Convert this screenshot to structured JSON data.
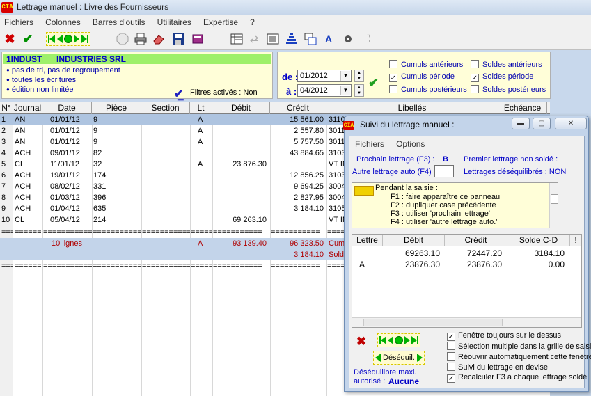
{
  "window": {
    "title": "Lettrage manuel : Livre des Fournisseurs",
    "logo": "CIA"
  },
  "menu": [
    "Fichiers",
    "Colonnes",
    "Barres d'outils",
    "Utilitaires",
    "Expertise",
    "?"
  ],
  "header": {
    "account_code": "1INDUST",
    "account_name": "INDUSTRIES SRL",
    "options": [
      "pas de tri, pas de regroupement",
      "toutes les écritures",
      "édition non limitée"
    ],
    "filters": "Filtres activés : Non"
  },
  "period": {
    "from_label": "de :",
    "to_label": "à :",
    "from_value": "01/2012",
    "to_value": "04/2012",
    "checks": [
      {
        "label": "Cumuls antérieurs",
        "checked": false
      },
      {
        "label": "Soldes antérieurs",
        "checked": false
      },
      {
        "label": "Cumuls période",
        "checked": true
      },
      {
        "label": "Soldes période",
        "checked": true
      },
      {
        "label": "Cumuls postérieurs",
        "checked": false
      },
      {
        "label": "Soldes postérieurs",
        "checked": false
      }
    ]
  },
  "grid": {
    "columns": [
      "N°",
      "Journal",
      "Date",
      "Pièce",
      "Section",
      "Lt",
      "Débit",
      "Crédit",
      "Libellés",
      "Echéance"
    ],
    "rows": [
      [
        "1",
        "AN",
        "01/01/12",
        "9",
        "",
        "A",
        "",
        "15 561.00",
        "3110"
      ],
      [
        "2",
        "AN",
        "01/01/12",
        "9",
        "",
        "A",
        "",
        "2 557.80",
        "3011"
      ],
      [
        "3",
        "AN",
        "01/01/12",
        "9",
        "",
        "A",
        "",
        "5 757.50",
        "3011"
      ],
      [
        "4",
        "ACH",
        "09/01/12",
        "82",
        "",
        "",
        "",
        "43 884.65",
        "3103"
      ],
      [
        "5",
        "CL",
        "11/01/12",
        "32",
        "",
        "A",
        "23 876.30",
        "",
        "VT IN"
      ],
      [
        "6",
        "ACH",
        "19/01/12",
        "174",
        "",
        "",
        "",
        "12 856.25",
        "3103"
      ],
      [
        "7",
        "ACH",
        "08/02/12",
        "331",
        "",
        "",
        "",
        "9 694.25",
        "3004"
      ],
      [
        "8",
        "ACH",
        "01/03/12",
        "396",
        "",
        "",
        "",
        "2 827.95",
        "3004"
      ],
      [
        "9",
        "ACH",
        "01/04/12",
        "635",
        "",
        "",
        "",
        "3 184.10",
        "3105"
      ],
      [
        "10",
        "CL",
        "05/04/12",
        "214",
        "",
        "",
        "69 263.10",
        "",
        "VT IN"
      ]
    ],
    "sep_short": "======",
    "sep_long": "===========",
    "total": {
      "count": "10 lignes",
      "lt": "A",
      "debit": "93 139.40",
      "credit": "96 323.50",
      "label": "Cumu"
    },
    "balance": {
      "credit": "3 184.10",
      "label": "Sold"
    }
  },
  "dialog": {
    "title": "Suivi du lettrage manuel :",
    "menu": [
      "Fichiers",
      "Options"
    ],
    "next_label": "Prochain lettrage (F3) :",
    "next_value": "B",
    "first_unsolved": "Premier lettrage non soldé :",
    "auto_label": "Autre lettrage auto (F4) :",
    "unbalanced": "Lettrages déséquilibrés : NON",
    "help_title": "Pendant la saisie :",
    "help_lines": [
      "F1 : faire apparaître ce panneau",
      "F2 : dupliquer case précédente",
      "F3 : utiliser 'prochain lettrage'",
      "F4 : utiliser 'autre lettrage auto.'"
    ],
    "table_headers": [
      "Lettre",
      "Débit",
      "Crédit",
      "Solde C-D",
      "!"
    ],
    "table_rows": [
      [
        "",
        "69263.10",
        "72447.20",
        "3184.10"
      ],
      [
        "A",
        "23876.30",
        "23876.30",
        "0.00"
      ]
    ],
    "deseq_button": "Déséquil.",
    "max_label": "Déséquilibre maxi.",
    "auth_label": "autorisé :",
    "auth_value": "Aucune",
    "options": [
      {
        "label": "Fenêtre toujours sur le dessus",
        "checked": true
      },
      {
        "label": "Sélection multiple dans la grille de saisie",
        "checked": false
      },
      {
        "label": "Réouvrir automatiquement cette fenêtre",
        "checked": false
      },
      {
        "label": "Suivi du lettrage en devise",
        "checked": false
      },
      {
        "label": "Recalculer F3 à chaque lettrage soldé",
        "checked": true
      }
    ]
  }
}
